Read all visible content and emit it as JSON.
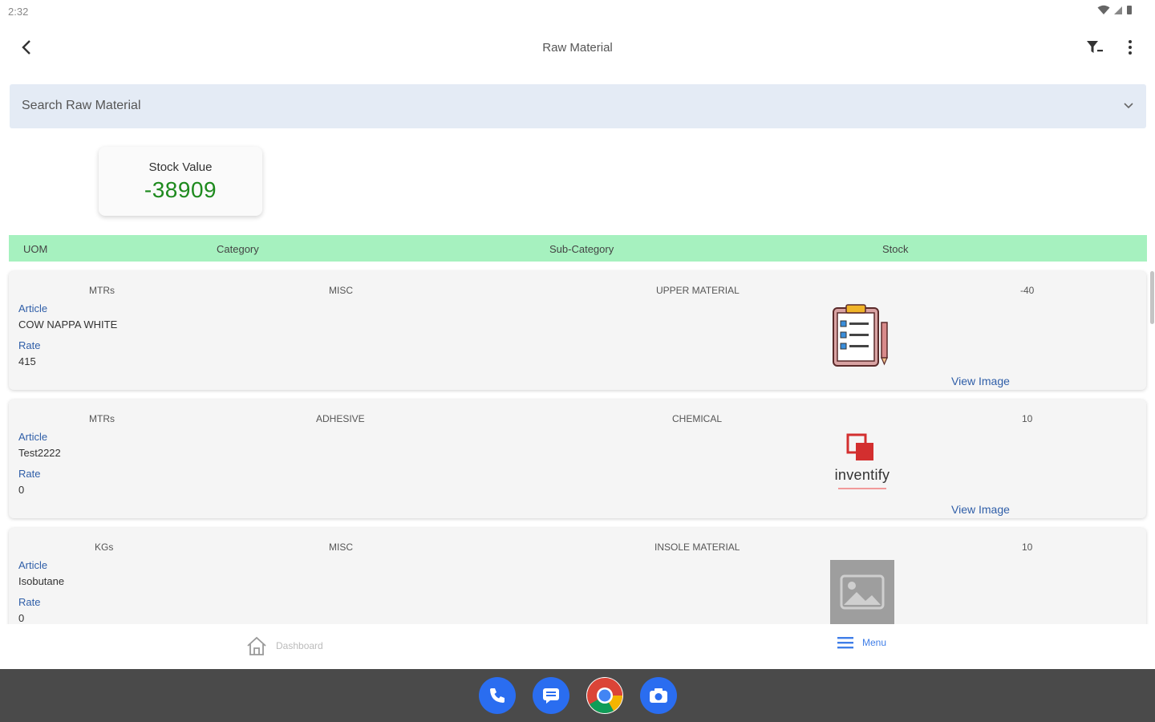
{
  "status_bar": {
    "time": "2:32"
  },
  "app_bar": {
    "title": "Raw Material"
  },
  "search": {
    "placeholder": "Search Raw Material"
  },
  "summary": {
    "label": "Stock Value",
    "value": "-38909"
  },
  "table": {
    "headers": [
      "UOM",
      "Category",
      "Sub-Category",
      "Stock"
    ],
    "rows": [
      {
        "uom": "MTRs",
        "category": "MISC",
        "sub_category": "UPPER MATERIAL",
        "stock": "-40",
        "article_label": "Article",
        "article": "COW NAPPA WHITE",
        "rate_label": "Rate",
        "rate": "415",
        "image": "clipboard-checklist-icon",
        "view_label": "View Image"
      },
      {
        "uom": "MTRs",
        "category": "ADHESIVE",
        "sub_category": "CHEMICAL",
        "stock": "10",
        "article_label": "Article",
        "article": "Test2222",
        "rate_label": "Rate",
        "rate": "0",
        "image": "inventify-logo",
        "image_text": "inventify",
        "view_label": "View Image"
      },
      {
        "uom": "KGs",
        "category": "MISC",
        "sub_category": "INSOLE MATERIAL",
        "stock": "10",
        "article_label": "Article",
        "article": "Isobutane",
        "rate_label": "Rate",
        "rate": "0",
        "image": "image-placeholder-icon"
      }
    ]
  },
  "bottom_nav": {
    "dashboard": "Dashboard",
    "menu": "Menu"
  },
  "dock": [
    "phone-icon",
    "messages-icon",
    "chrome-icon",
    "camera-icon"
  ],
  "colors": {
    "accent": "#2f5ea8",
    "header_bg": "#a6f1bf",
    "stock_value": "#1e8a1e",
    "search_bg": "#e4ebf5"
  }
}
